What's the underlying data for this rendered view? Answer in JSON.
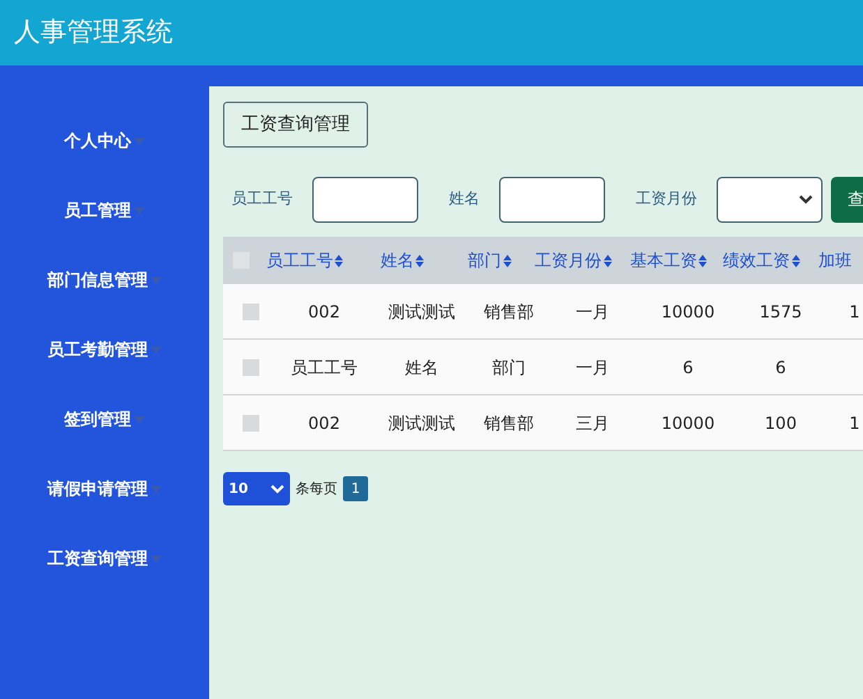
{
  "header": {
    "title": "人事管理系统"
  },
  "sidebar": {
    "items": [
      {
        "label": "个人中心"
      },
      {
        "label": "员工管理"
      },
      {
        "label": "部门信息管理"
      },
      {
        "label": "员工考勤管理"
      },
      {
        "label": "签到管理"
      },
      {
        "label": "请假申请管理"
      },
      {
        "label": "工资查询管理"
      }
    ]
  },
  "breadcrumb": "工资查询管理",
  "search": {
    "fields": [
      {
        "kind": "text",
        "label": "员工工号"
      },
      {
        "kind": "text",
        "label": "姓名"
      },
      {
        "kind": "select",
        "label": "工资月份"
      }
    ],
    "button": "查"
  },
  "table": {
    "all_checked": false,
    "columns": [
      "员工工号",
      "姓名",
      "部门",
      "工资月份",
      "基本工资",
      "绩效工资",
      "加班"
    ],
    "rows": [
      {
        "checked": false,
        "cells": [
          "002",
          "测试测试",
          "销售部",
          "一月",
          "10000",
          "1575",
          "1"
        ]
      },
      {
        "checked": false,
        "cells": [
          "员工工号",
          "姓名",
          "部门",
          "一月",
          "6",
          "6",
          ""
        ]
      },
      {
        "checked": false,
        "cells": [
          "002",
          "测试测试",
          "销售部",
          "三月",
          "10000",
          "100",
          "1"
        ]
      }
    ]
  },
  "pagination": {
    "page_size": "10",
    "label": "条每页",
    "pages": [
      {
        "label": "1",
        "selected": true
      }
    ]
  }
}
